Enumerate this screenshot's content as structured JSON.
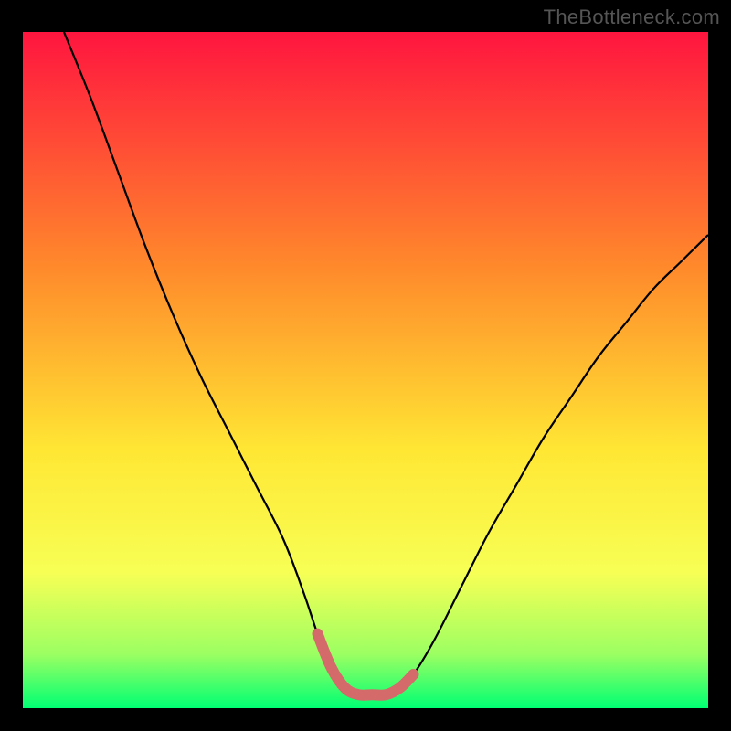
{
  "attribution": "TheBottleneck.com",
  "chart_data": {
    "type": "line",
    "title": "",
    "xlabel": "",
    "ylabel": "",
    "xlim": [
      0,
      100
    ],
    "ylim": [
      0,
      100
    ],
    "gradient_colors": {
      "top": "#ff153f",
      "upper_mid": "#ff8a2b",
      "mid": "#ffe734",
      "lower_mid": "#f7ff55",
      "low": "#9cff62",
      "bottom": "#00ff73"
    },
    "gradient_stops_pct": [
      0,
      35,
      62,
      80,
      92,
      100
    ],
    "series": [
      {
        "name": "bottleneck-curve",
        "color": "#000000",
        "width": 2.2,
        "x": [
          6,
          10,
          14,
          18,
          22,
          26,
          30,
          34,
          38,
          41,
          43,
          45,
          47,
          49,
          51,
          53,
          55,
          57,
          60,
          64,
          68,
          72,
          76,
          80,
          84,
          88,
          92,
          96,
          100
        ],
        "values": [
          100,
          90,
          79,
          68,
          58,
          49,
          41,
          33,
          25,
          17,
          11,
          6,
          3,
          2,
          2,
          2,
          3,
          5,
          10,
          18,
          26,
          33,
          40,
          46,
          52,
          57,
          62,
          66,
          70
        ]
      },
      {
        "name": "optimal-flat-region",
        "color": "#d46a6a",
        "width": 12,
        "x": [
          43,
          45,
          47,
          49,
          51,
          53,
          55,
          57
        ],
        "values": [
          11,
          6,
          3,
          2,
          2,
          2,
          3,
          5
        ]
      }
    ]
  }
}
